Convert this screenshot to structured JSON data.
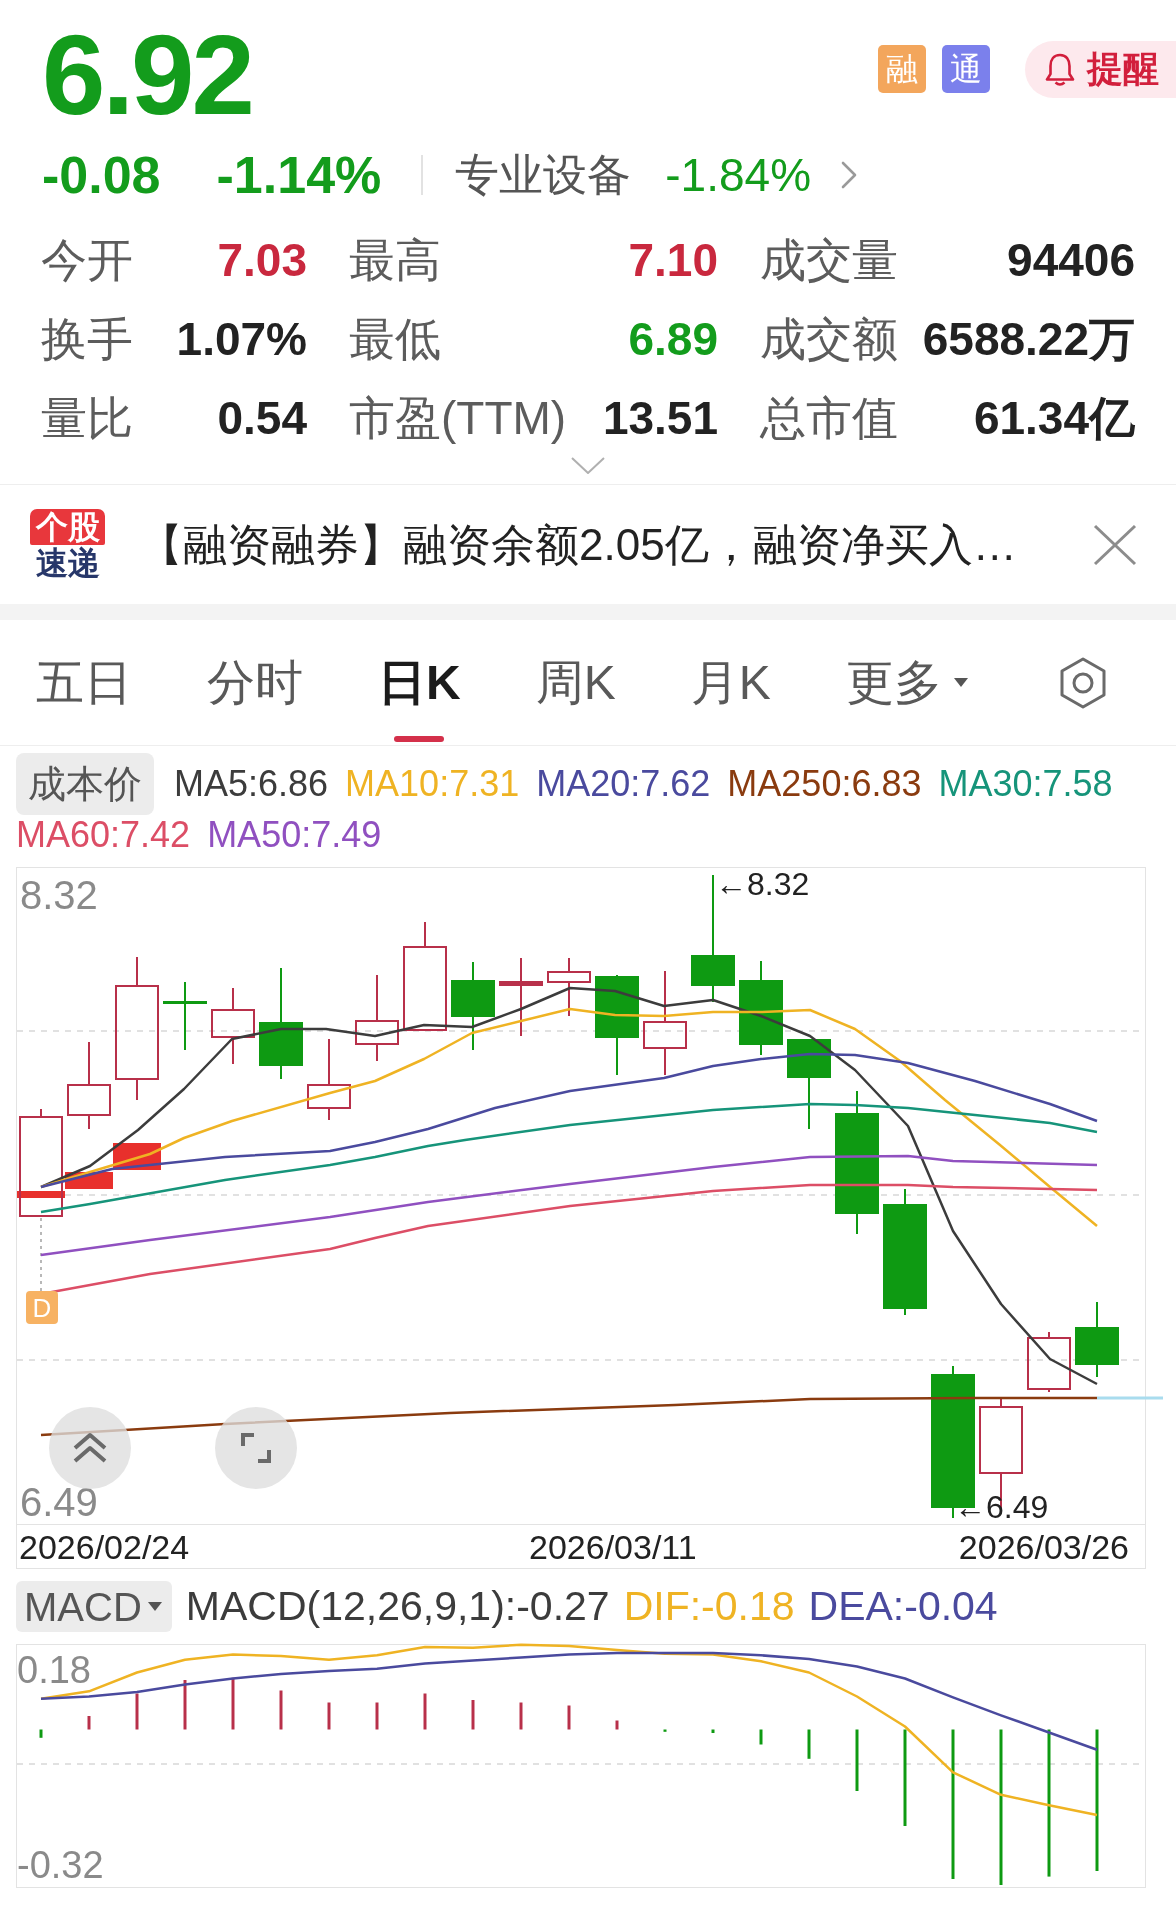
{
  "quote": {
    "price": "6.92",
    "falling": true,
    "change": "-0.08",
    "change_percent": "-1.14%",
    "sector": "专业设备",
    "sector_change": "-1.84%",
    "sector_falling": true
  },
  "badges": [
    {
      "label": "融",
      "color": "#f3a65c"
    },
    {
      "label": "通",
      "color": "#7b80ec"
    }
  ],
  "alert_button": {
    "label": "提醒"
  },
  "stats": [
    {
      "label": "今开",
      "value": "7.03",
      "color": "#c9283e"
    },
    {
      "label": "最高",
      "value": "7.10",
      "color": "#c9283e"
    },
    {
      "label": "成交量",
      "value": "94406",
      "color": "#222222"
    },
    {
      "label": "换手",
      "value": "1.07%",
      "color": "#222222"
    },
    {
      "label": "最低",
      "value": "6.89",
      "color": "#139c1c"
    },
    {
      "label": "成交额",
      "value": "6588.22万",
      "color": "#222222"
    },
    {
      "label": "量比",
      "value": "0.54",
      "color": "#222222"
    },
    {
      "label": "市盈(TTM)",
      "value": "13.51",
      "color": "#222222"
    },
    {
      "label": "总市值",
      "value": "61.34亿",
      "color": "#222222"
    }
  ],
  "news": {
    "logo_top": "个股",
    "logo_bottom": "速递",
    "text": "【融资融券】融资余额2.05亿，融资净买入…"
  },
  "tabs": [
    {
      "label": "五日",
      "selected": false,
      "kind": "plain"
    },
    {
      "label": "分时",
      "selected": false,
      "kind": "plain"
    },
    {
      "label": "日K",
      "selected": true,
      "kind": "plain"
    },
    {
      "label": "周K",
      "selected": false,
      "kind": "plain"
    },
    {
      "label": "月K",
      "selected": false,
      "kind": "plain"
    },
    {
      "label": "更多",
      "selected": false,
      "kind": "dropdown"
    }
  ],
  "ma_legend": {
    "button": "成本价",
    "items": [
      {
        "label": "MA5:6.86",
        "color": "#3c3c3c"
      },
      {
        "label": "MA10:7.31",
        "color": "#efb323"
      },
      {
        "label": "MA20:7.62",
        "color": "#4a4a9e"
      },
      {
        "label": "MA250:6.83",
        "color": "#8a3b0f"
      },
      {
        "label": "MA30:7.58",
        "color": "#16947a"
      },
      {
        "label": "MA60:7.42",
        "color": "#dc4e66"
      },
      {
        "label": "MA50:7.49",
        "color": "#9050c0"
      }
    ]
  },
  "kline_chart": {
    "top_label": "8.32",
    "bottom_label": "6.49",
    "high_marker": "←8.32",
    "low_marker": "←6.49",
    "signal_badge": "D",
    "dates": [
      "2026/02/24",
      "2026/03/11",
      "2026/03/26"
    ]
  },
  "macd": {
    "selector": "MACD",
    "legend": [
      {
        "label": "MACD(12,26,9,1):-0.27",
        "color": "#3c3c3c"
      },
      {
        "label": "DIF:-0.18",
        "color": "#efb323"
      },
      {
        "label": "DEA:-0.04",
        "color": "#4a4a9e"
      }
    ],
    "top_label": "0.18",
    "bottom_label": "-0.32"
  }
}
